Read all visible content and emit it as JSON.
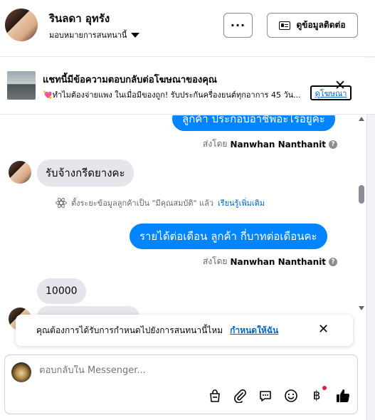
{
  "header": {
    "contact_name": "รินลดา อุทรัง",
    "assign_label": "มอบหมายการสนทนานี้",
    "more_label": "···",
    "contact_info_label": "ดูข้อมูลติดต่อ"
  },
  "ad_banner": {
    "title": "แชทนี้มีข้อความตอบกลับต่อโฆษณาของคุณ",
    "description": "💘ทำไมต้องจ่ายแพง ในเมื่อมีของถูก! รับประกันครื่องยนต์ทุกอาการ 45 วัน...",
    "view_ad_label": "ดูโฆษณา",
    "close_label": "✕"
  },
  "messages": {
    "out1": "ลูกค้า ประกอบอาชีพอะไรอยู่คะ",
    "sent_by_prefix1": "ส่งโดย",
    "sender1": "Nanwhan Nanthanit",
    "in1": "รับจ้างกรีดยางคะ",
    "system_note": "ตั้งระยะข้อมูลลูกค้าเป็น \"มีคุณสมบัติ\" แล้ว",
    "learn_more": "เรียนรู้เพิ่มเติม",
    "out2": "รายได้ต่อเดือน ลูกค้า  กี่บาทต่อเดือนคะ",
    "sent_by_prefix2": "ส่งโดย",
    "sender2": "Nanwhan Nanthanit",
    "in2": "10000"
  },
  "reminder": {
    "text": "คุณต้องการได้รับการกำหนดไปยังการสนทนานี้ไหม",
    "action": "กำหนดให้ฉัน",
    "close": "✕"
  },
  "composer": {
    "placeholder": "ตอบกลับใน Messenger..."
  },
  "colors": {
    "brand_blue": "#0084ff",
    "link_blue": "#0064d1",
    "incoming_bubble": "#e4e6eb",
    "notification_red": "#e41e3f"
  }
}
